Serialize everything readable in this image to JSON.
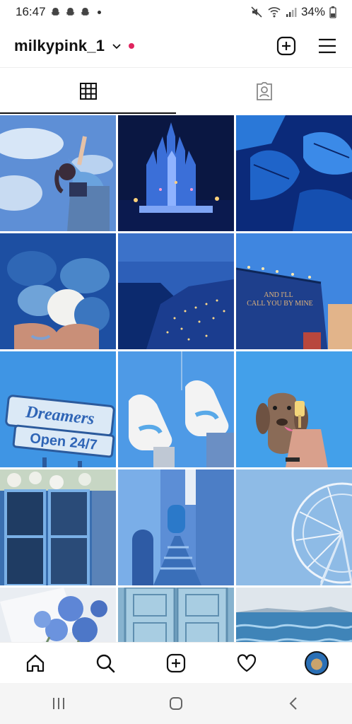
{
  "status_bar": {
    "time": "16:47",
    "battery": "34%"
  },
  "profile": {
    "username": "milkypink_1"
  },
  "tabs": [
    {
      "name": "grid-tab",
      "active": true
    },
    {
      "name": "tagged-tab",
      "active": false
    }
  ],
  "posts": [
    {
      "desc": "girl-sky"
    },
    {
      "desc": "castle-night"
    },
    {
      "desc": "blue-leaves"
    },
    {
      "desc": "yarn-hands"
    },
    {
      "desc": "santorini-night"
    },
    {
      "desc": "billboard"
    },
    {
      "desc": "dreamers-sign"
    },
    {
      "desc": "white-sneakers"
    },
    {
      "desc": "dog-icecream"
    },
    {
      "desc": "window-flowers"
    },
    {
      "desc": "blue-alley"
    },
    {
      "desc": "ferris-wheel"
    },
    {
      "desc": "roses-book"
    },
    {
      "desc": "blue-door"
    },
    {
      "desc": "sea-waves"
    }
  ],
  "sign_text": {
    "line1": "Dreamers",
    "line2": "Open 24/7"
  },
  "billboard_text": "AND I'LL CALL YOU BY MINE",
  "colors": {
    "accent_red": "#e0245e"
  }
}
